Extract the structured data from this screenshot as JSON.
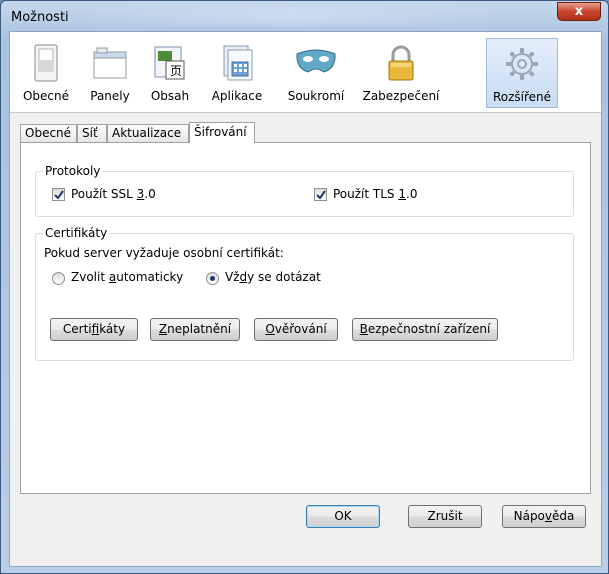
{
  "window": {
    "title": "Možnosti",
    "close_label": "x"
  },
  "toolbar": {
    "items": [
      {
        "label": "Obecné",
        "icon": "general-switch-icon"
      },
      {
        "label": "Panely",
        "icon": "tabs-window-icon"
      },
      {
        "label": "Obsah",
        "icon": "content-page-icon"
      },
      {
        "label": "Aplikace",
        "icon": "applications-icon"
      },
      {
        "label": "Soukromí",
        "icon": "privacy-mask-icon"
      },
      {
        "label": "Zabezpečení",
        "icon": "security-lock-icon"
      },
      {
        "label": "Rozšířené",
        "icon": "advanced-gear-icon"
      }
    ],
    "selected": "Rozšířené"
  },
  "tabs": {
    "items": [
      "Obecné",
      "Síť",
      "Aktualizace",
      "Šifrování"
    ],
    "selected": "Šifrování"
  },
  "protocols": {
    "legend": "Protokoly",
    "ssl": {
      "pre": "Použít SSL ",
      "key": "3",
      "post": ".0",
      "checked": true
    },
    "tls": {
      "pre": "Použít TLS ",
      "key": "1",
      "post": ".0",
      "checked": true
    }
  },
  "certificates": {
    "legend": "Certifikáty",
    "prompt": "Pokud server vyžaduje osobní certifikát:",
    "auto": {
      "pre": "Zvolit ",
      "key": "a",
      "post": "utomaticky",
      "selected": false
    },
    "ask": {
      "pre": "Vž",
      "key": "d",
      "post": "y se dotázat",
      "selected": true
    },
    "buttons": {
      "certs": {
        "pre": "Certi",
        "key": "f",
        "post": "ikáty"
      },
      "revoke": {
        "pre": "",
        "key": "Z",
        "post": "neplatnění"
      },
      "verify": {
        "pre": "",
        "key": "O",
        "post": "věřování"
      },
      "devices": {
        "pre": "",
        "key": "B",
        "post": "ezpečnostní zařízení"
      }
    }
  },
  "dialog_buttons": {
    "ok": "OK",
    "cancel": "Zrušit",
    "help": {
      "pre": "Nápo",
      "key": "v",
      "post": "ěda"
    }
  }
}
